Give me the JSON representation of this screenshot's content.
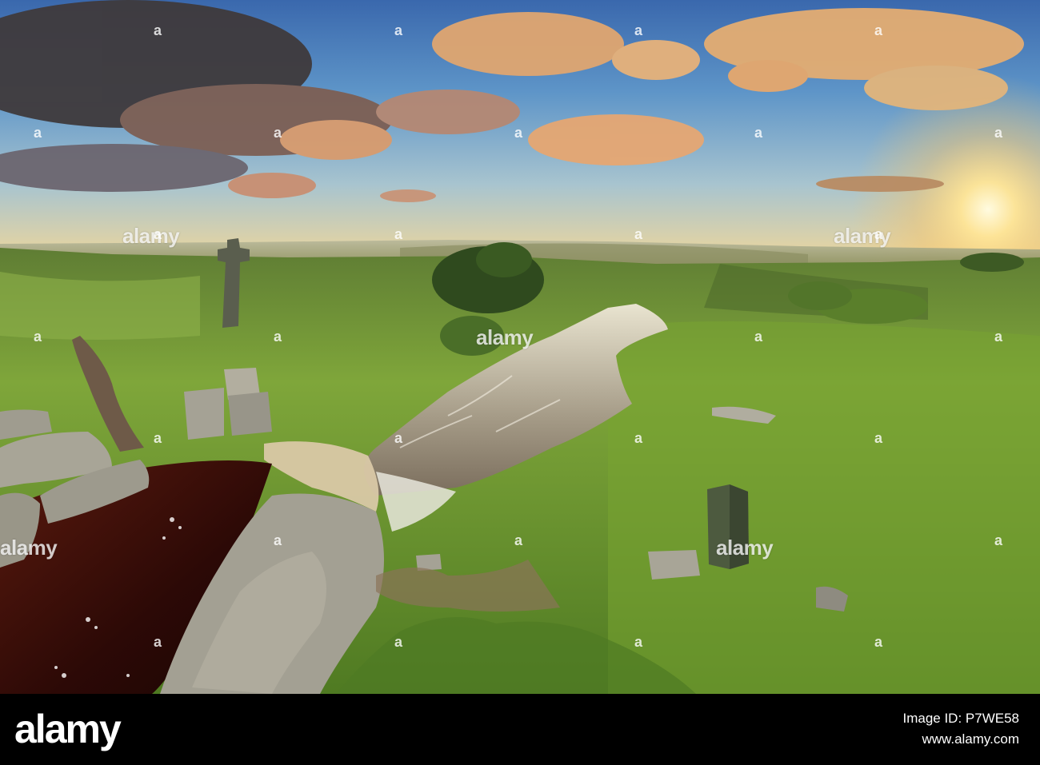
{
  "watermarks": {
    "brand": "alamy",
    "letter": "a"
  },
  "footer": {
    "logo": "alamy",
    "image_id_line": "Image ID: P7WE58",
    "url": "www.alamy.com"
  },
  "colors": {
    "footer_bg": "#000000",
    "sky_top": "#3d6fb0",
    "sun": "#fff3c2",
    "grass": "#6f9a33",
    "water": "#3a0d08"
  }
}
